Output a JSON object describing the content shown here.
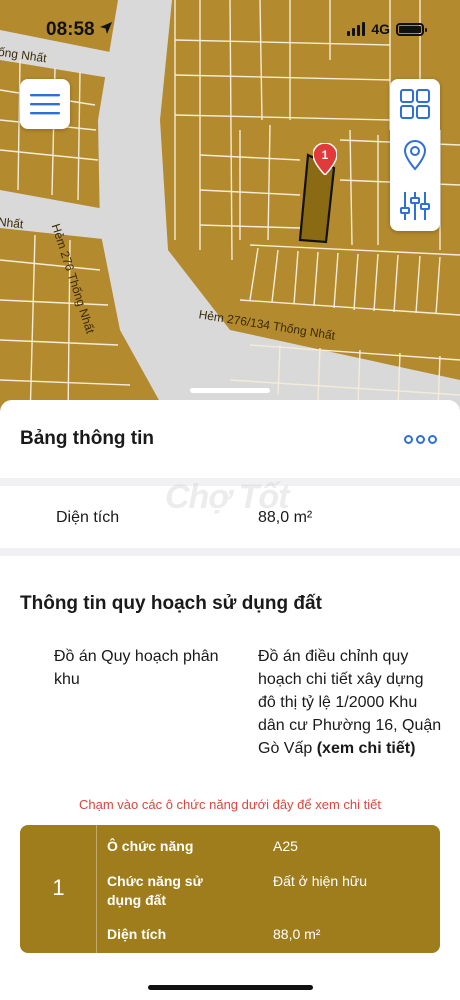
{
  "status_bar": {
    "time": "08:58",
    "network": "4G"
  },
  "map": {
    "labels": {
      "street_top_left": "ống Nhất",
      "street_left": "Nhất",
      "alley_276": "Hẻm 276 Thống Nhất",
      "alley_276_134": "Hẻm 276/134 Thống Nhất"
    },
    "marker_number": "1",
    "colors": {
      "land": "#b48a2e",
      "road": "#d9d9d9",
      "parcel_line": "#f3ecd8",
      "selected_parcel": "#8a6a12",
      "marker": "#e03a3a"
    },
    "icons": [
      "menu-icon",
      "grid-icon",
      "location-pin-icon",
      "sliders-icon"
    ]
  },
  "sheet": {
    "title": "Bảng thông tin",
    "area_label": "Diện tích",
    "area_value": "88,0 m²",
    "watermark": "Chợ Tốt",
    "planning_title": "Thông tin quy hoạch sử dụng đất",
    "plan_label": "Đồ án Quy hoạch phân khu",
    "plan_value": "Đồ án điều chỉnh quy hoạch chi tiết xây dựng đô thị tỷ lệ 1/2000 Khu dân cư Phường 16, Quận Gò Vấp",
    "plan_link": "(xem chi tiết)",
    "hint": "Chạm vào các ô chức năng dưới đây để xem chi tiết",
    "function_card": {
      "index": "1",
      "rows": [
        {
          "label": "Ô chức năng",
          "value": "A25"
        },
        {
          "label": "Chức năng sử dụng đất",
          "value": "Đất ở hiện hữu"
        },
        {
          "label": "Diện tích",
          "value": "88,0 m²"
        }
      ],
      "color": "#a07d1c"
    }
  }
}
